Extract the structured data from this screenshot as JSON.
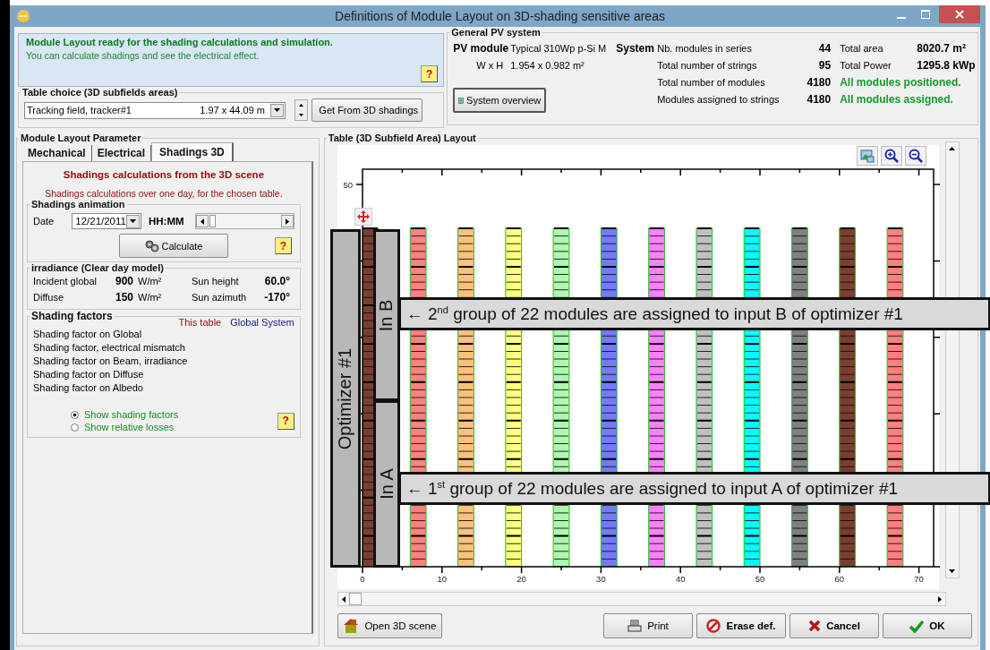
{
  "window": {
    "title": "Definitions of Module Layout on 3D-shading sensitive areas"
  },
  "status_panel": {
    "headline": "Module Layout ready for the shading calculations and simulation.",
    "detail": "You can calculate shadings and see the electrical effect.",
    "help": "?"
  },
  "table_choice": {
    "title": "Table choice  (3D subfields areas)",
    "table": "Tracking field, tracker#1",
    "size": "1.97 x 44.09 m",
    "button": "Get From 3D shadings"
  },
  "general_pv_system": {
    "title": "General PV system",
    "module_label": "PV module",
    "module": "Typical 310Wp p-Si M",
    "dims_label": "W x H",
    "dims": "1.954 x 0.982 m²",
    "system_label": "System",
    "rows": [
      {
        "label": "Nb. modules in series",
        "value": "44",
        "kind": "pair",
        "side_label": "Total area",
        "side_value": "8020.7 m²"
      },
      {
        "label": "Total number of strings",
        "value": "95",
        "kind": "pair",
        "side_label": "Total Power",
        "side_value": "1295.8 kWp"
      },
      {
        "label": "Total number of modules",
        "value": "4180",
        "kind": "status",
        "status": "All modules positioned."
      },
      {
        "label": "Modules assigned to strings",
        "value": "4180",
        "kind": "status",
        "status": "All modules assigned."
      }
    ],
    "overview_button": "System overview"
  },
  "layout_parameter": {
    "title": "Module Layout Parameter",
    "tabs": [
      {
        "label": "Mechanical",
        "selected": false
      },
      {
        "label": "Electrical",
        "selected": false
      },
      {
        "label": "Shadings 3D",
        "selected": true
      }
    ],
    "heading": "Shadings calculations from the 3D scene",
    "subheading": "Shadings calculations over one day, for the chosen table.",
    "animation": {
      "title": "Shadings animation",
      "date_label": "Date",
      "date": "12/21/2011",
      "time_label": "HH:MM",
      "calculate": "Calculate",
      "help": "?"
    },
    "irradiance": {
      "title": "irradiance (Clear day model)",
      "rows": [
        {
          "label": "Incident global",
          "value": "900",
          "unit": "W/m²",
          "angle_label": "Sun height",
          "angle": "60.0°"
        },
        {
          "label": "Diffuse",
          "value": "150",
          "unit": "W/m²",
          "angle_label": "Sun azimuth",
          "angle": "-170°"
        }
      ]
    },
    "shading_factors": {
      "title": "Shading factors",
      "columns": [
        "This table",
        "Global System"
      ],
      "items": [
        "Shading factor on Global",
        "Shading factor, electrical mismatch",
        "Shading factor on Beam, irradiance",
        "Shading factor on Diffuse",
        "Shading factor on Albedo"
      ],
      "options": [
        {
          "label": "Show shading factors",
          "selected": true
        },
        {
          "label": "Show relative losses",
          "selected": false
        }
      ],
      "help": "?"
    }
  },
  "layout_view": {
    "title": "Table (3D Subfield Area) Layout",
    "x_labels": [
      "0",
      "10",
      "20",
      "30",
      "40",
      "50",
      "60",
      "70"
    ],
    "y_labels": [
      "50"
    ],
    "strings": [
      {
        "color": "#7a3f30"
      },
      {
        "color": "#ff8080"
      },
      {
        "color": "#ffc080"
      },
      {
        "color": "#ffff80"
      },
      {
        "color": "#b0f5b0"
      },
      {
        "color": "#7878ff"
      },
      {
        "color": "#ff80ff"
      },
      {
        "color": "#c0c0c0"
      },
      {
        "color": "#00ffff"
      },
      {
        "color": "#808080"
      },
      {
        "color": "#7a3f30"
      },
      {
        "color": "#ff8080"
      }
    ],
    "optimizer": "Optimizer #1",
    "inputs": [
      "In B",
      "In A"
    ],
    "callouts": [
      "← 2$^{nd}$ group of 22 modules are assigned to input B of optimizer #1",
      "← 1$^{st}$ group of 22 modules are assigned to input A of optimizer #1"
    ]
  },
  "buttons": [
    {
      "label": "Open 3D scene",
      "kind": "scene"
    },
    {
      "label": "Print",
      "kind": "print"
    },
    {
      "label": "Erase def.",
      "kind": "erase"
    },
    {
      "label": "Cancel",
      "kind": "cancel"
    },
    {
      "label": "OK",
      "kind": "ok"
    }
  ]
}
